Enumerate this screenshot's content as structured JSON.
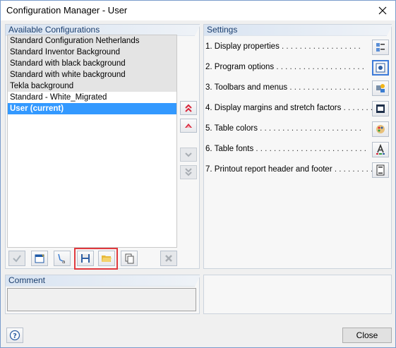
{
  "window": {
    "title": "Configuration Manager - User"
  },
  "available": {
    "header": "Available Configurations",
    "items": [
      {
        "label": "Standard Configuration Netherlands"
      },
      {
        "label": "Standard Inventor Background"
      },
      {
        "label": "Standard with black background"
      },
      {
        "label": "Standard with white background"
      },
      {
        "label": "Tekla background"
      },
      {
        "label": "Standard - White_Migrated"
      },
      {
        "label": "User (current)",
        "selected": true
      }
    ]
  },
  "settings": {
    "header": "Settings",
    "items": [
      {
        "label": "1. Display properties",
        "icon": "display-properties-icon"
      },
      {
        "label": "2. Program options",
        "icon": "program-options-icon"
      },
      {
        "label": "3. Toolbars and menus",
        "icon": "toolbars-menus-icon"
      },
      {
        "label": "4. Display margins and stretch factors",
        "icon": "display-margins-icon"
      },
      {
        "label": "5. Table colors",
        "icon": "table-colors-icon"
      },
      {
        "label": "6. Table fonts",
        "icon": "table-fonts-icon"
      },
      {
        "label": "7. Printout report header and footer",
        "icon": "printout-report-icon"
      }
    ]
  },
  "comment": {
    "header": "Comment",
    "value": ""
  },
  "footer": {
    "close_label": "Close"
  },
  "colors": {
    "accent": "#3399ff",
    "highlight": "#e0393e",
    "active_border": "#3d7bd9"
  }
}
